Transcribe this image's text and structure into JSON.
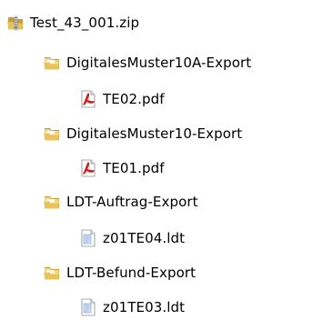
{
  "tree": {
    "root": {
      "label": "Test_43_001.zip",
      "icon": "zip-folder-icon"
    },
    "items": [
      {
        "label": "DigitalesMuster10A-Export",
        "icon": "folder-icon"
      },
      {
        "label": "TE02.pdf",
        "icon": "pdf-file-icon"
      },
      {
        "label": "DigitalesMuster10-Export",
        "icon": "folder-icon"
      },
      {
        "label": "TE01.pdf",
        "icon": "pdf-file-icon"
      },
      {
        "label": "LDT-Auftrag-Export",
        "icon": "folder-icon"
      },
      {
        "label": "z01TE04.ldt",
        "icon": "text-file-icon"
      },
      {
        "label": "LDT-Befund-Export",
        "icon": "folder-icon"
      },
      {
        "label": "z01TE03.ldt",
        "icon": "text-file-icon"
      }
    ]
  },
  "colors": {
    "folder": "#e8c35a",
    "folder_dark": "#c99a2e",
    "pdf_red": "#cc1f1f",
    "file_blue": "#7ea6d8"
  }
}
